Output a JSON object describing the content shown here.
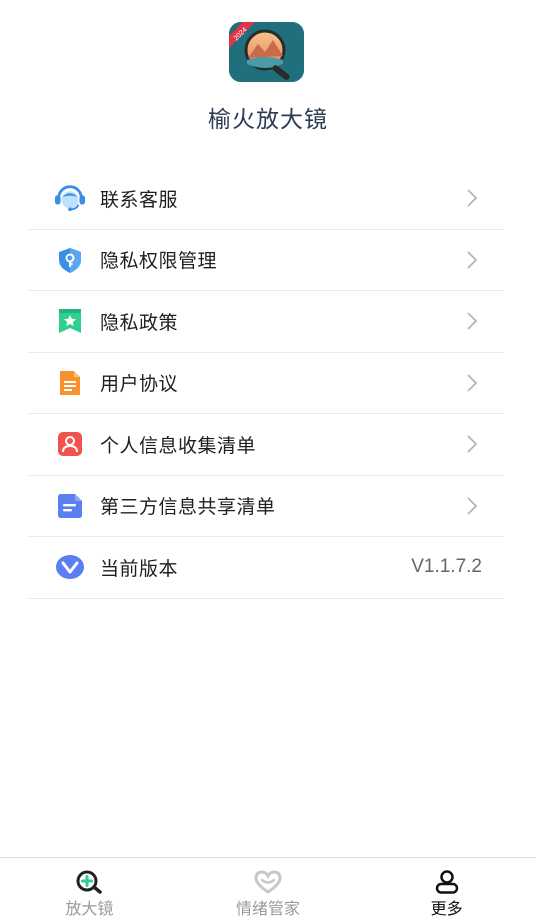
{
  "header": {
    "app_name": "榆火放大镜",
    "logo_badge": "2024"
  },
  "menu": {
    "items": [
      {
        "label": "联系客服",
        "icon": "customer-service-icon"
      },
      {
        "label": "隐私权限管理",
        "icon": "shield-key-icon"
      },
      {
        "label": "隐私政策",
        "icon": "bookmark-star-icon"
      },
      {
        "label": "用户协议",
        "icon": "document-icon"
      },
      {
        "label": "个人信息收集清单",
        "icon": "person-card-icon"
      },
      {
        "label": "第三方信息共享清单",
        "icon": "list-doc-icon"
      },
      {
        "label": "当前版本",
        "icon": "version-v-icon",
        "value": "V1.1.7.2"
      }
    ]
  },
  "tabbar": {
    "tabs": [
      {
        "label": "放大镜",
        "icon": "magnifier-plus-icon",
        "active": false
      },
      {
        "label": "情绪管家",
        "icon": "heart-icon",
        "active": false
      },
      {
        "label": "更多",
        "icon": "person-icon",
        "active": true
      }
    ]
  },
  "colors": {
    "title": "#2b3b52",
    "divider": "#ebebeb",
    "inactive_tab": "#9a9a9a",
    "active_tab": "#111111"
  }
}
